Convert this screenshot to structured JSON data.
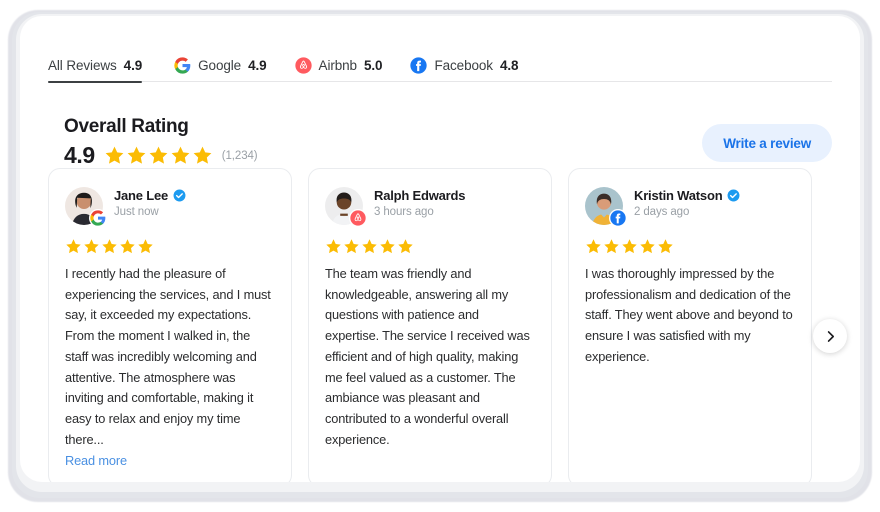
{
  "tabs": [
    {
      "label": "All Reviews",
      "score": "4.9",
      "icon": "none",
      "active": true
    },
    {
      "label": "Google",
      "score": "4.9",
      "icon": "google-icon",
      "active": false
    },
    {
      "label": "Airbnb",
      "score": "5.0",
      "icon": "airbnb-icon",
      "active": false
    },
    {
      "label": "Facebook",
      "score": "4.8",
      "icon": "facebook-icon",
      "active": false
    }
  ],
  "overall": {
    "title": "Overall Rating",
    "value": "4.9",
    "stars": 5,
    "count": "(1,234)"
  },
  "actions": {
    "write_review_label": "Write a review",
    "next_arrow_icon": "chevron-right-icon",
    "read_more_label": "Read more"
  },
  "reviews": [
    {
      "name": "Jane Lee",
      "verified": true,
      "timestamp": "Just now",
      "source": "google-icon",
      "stars": 5,
      "text": "I recently had the pleasure of experiencing the services, and I must say, it exceeded my expectations. From the moment I walked in, the staff was incredibly welcoming and attentive. The atmosphere was inviting and comfortable, making it easy to relax and enjoy my time there...",
      "has_read_more": true
    },
    {
      "name": "Ralph Edwards",
      "verified": false,
      "timestamp": "3 hours ago",
      "source": "airbnb-icon",
      "stars": 5,
      "text": "The team was friendly and knowledgeable, answering all my questions with patience and expertise. The service I received was efficient and of high quality, making me feel valued as a customer. The ambiance was pleasant and contributed to a wonderful overall experience.",
      "has_read_more": false
    },
    {
      "name": "Kristin Watson",
      "verified": true,
      "timestamp": "2 days ago",
      "source": "facebook-icon",
      "stars": 5,
      "text": "I was thoroughly impressed by the professionalism and dedication of the staff. They went above and beyond to ensure I was satisfied with my experience.",
      "has_read_more": false
    }
  ],
  "colors": {
    "star": "#FBBC04",
    "accent_blue": "#1a73e8",
    "link_blue": "#4a90e2",
    "button_bg": "#e8f1fe",
    "airbnb_red": "#FF5A5F",
    "facebook_blue": "#1877F2",
    "verified_blue": "#1d9bf0",
    "card_border": "#eaecef",
    "text_primary": "#1b1b1f",
    "text_muted": "#9aa0a6"
  }
}
